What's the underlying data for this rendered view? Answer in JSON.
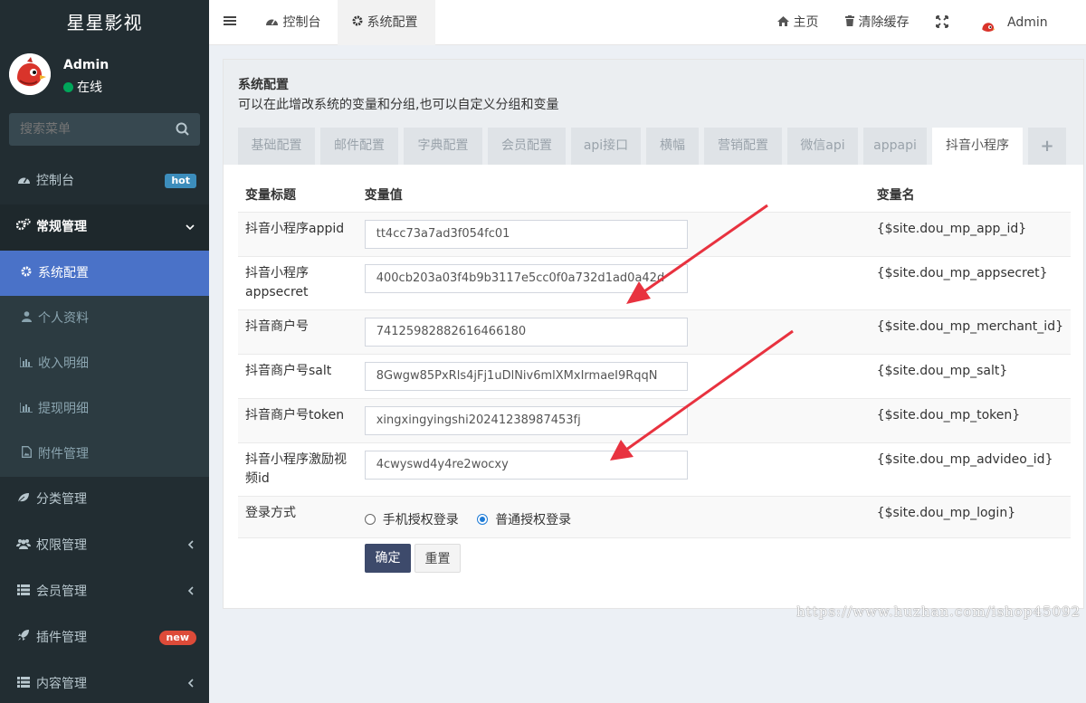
{
  "app": {
    "brand": "星星影视"
  },
  "user": {
    "name": "Admin",
    "status": "在线"
  },
  "search": {
    "placeholder": "搜索菜单"
  },
  "sidebar": {
    "items": [
      {
        "label": "控制台",
        "badge": "hot",
        "icon": "dashboard-icon"
      },
      {
        "label": "常规管理",
        "icon": "cogs-icon",
        "expanded": true
      },
      {
        "label": "分类管理",
        "icon": "leaf-icon"
      },
      {
        "label": "权限管理",
        "icon": "users-icon"
      },
      {
        "label": "会员管理",
        "icon": "list-icon"
      },
      {
        "label": "插件管理",
        "badge": "new",
        "icon": "rocket-icon"
      },
      {
        "label": "内容管理",
        "icon": "list-icon"
      }
    ],
    "sub_items": [
      {
        "label": "系统配置",
        "icon": "gear-icon",
        "active": true
      },
      {
        "label": "个人资料",
        "icon": "user-icon"
      },
      {
        "label": "收入明细",
        "icon": "bar-chart-icon"
      },
      {
        "label": "提现明细",
        "icon": "bar-chart-icon"
      },
      {
        "label": "附件管理",
        "icon": "file-image-icon"
      }
    ]
  },
  "navbar": {
    "tabs": [
      {
        "label": "控制台",
        "icon": "dashboard-icon"
      },
      {
        "label": "系统配置",
        "icon": "gear-icon",
        "active": true
      }
    ],
    "home": "主页",
    "clear_cache": "清除缓存",
    "user": "Admin"
  },
  "panel": {
    "title": "系统配置",
    "description": "可以在此增改系统的变量和分组,也可以自定义分组和变量",
    "tabs": [
      "基础配置",
      "邮件配置",
      "字典配置",
      "会员配置",
      "api接口",
      "横幅",
      "营销配置",
      "微信api",
      "appapi",
      "抖音小程序",
      "+"
    ],
    "active_tab": "抖音小程序",
    "columns": [
      "变量标题",
      "变量值",
      "变量名"
    ],
    "rows": [
      {
        "title": "抖音小程序appid",
        "value": "tt4cc73a7ad3f054fc01",
        "name": "{$site.dou_mp_app_id}"
      },
      {
        "title": "抖音小程序appsecret",
        "value": "400cb203a03f4b9b3117e5cc0f0a732d1ad0a42d",
        "name": "{$site.dou_mp_appsecret}"
      },
      {
        "title": "抖音商户号",
        "value": "74125982882616466180",
        "name": "{$site.dou_mp_merchant_id}"
      },
      {
        "title": "抖音商户号salt",
        "value": "8Gwgw85PxRls4jFj1uDlNiv6mlXMxIrmaeI9RqqN",
        "name": "{$site.dou_mp_salt}"
      },
      {
        "title": "抖音商户号token",
        "value": "xingxingyingshi20241238987453fj",
        "name": "{$site.dou_mp_token}"
      },
      {
        "title": "抖音小程序激励视频id",
        "value": "4cwyswd4y4re2wocxy",
        "name": "{$site.dou_mp_advideo_id}"
      }
    ],
    "login": {
      "title": "登录方式",
      "options": [
        "手机授权登录",
        "普通授权登录"
      ],
      "selected": "普通授权登录",
      "name": "{$site.dou_mp_login}"
    },
    "buttons": {
      "ok": "确定",
      "reset": "重置"
    }
  },
  "watermark": "https://www.huzhan.com/ishop45092",
  "colors": {
    "sidebar": "#222d32",
    "active": "#4a72c8",
    "primary_button": "#3d4a6b",
    "annotation_arrow": "#e8323f"
  }
}
